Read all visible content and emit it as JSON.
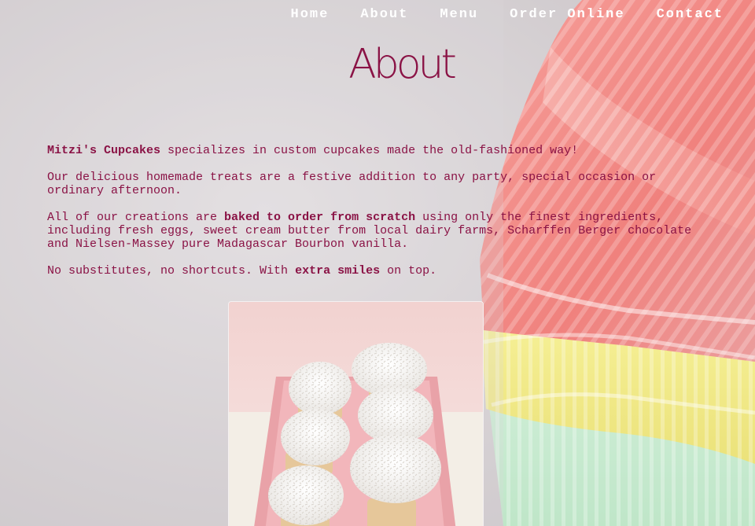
{
  "nav": {
    "items": [
      {
        "label": "Home"
      },
      {
        "label": "About"
      },
      {
        "label": "Menu"
      },
      {
        "label": "Order Online"
      },
      {
        "label": "Contact"
      }
    ]
  },
  "page": {
    "title": "About"
  },
  "about": {
    "p1": {
      "brand": "Mitzi's Cupcakes",
      "rest": " specializes in custom cupcakes made the old-fashioned way!"
    },
    "p2": "Our delicious homemade treats are a festive addition to any party, special occasion or ordinary afternoon.",
    "p3": {
      "pre": "All of our creations are ",
      "bold": "baked to order from scratch",
      "post": " using only the finest ingredients, including fresh eggs, sweet cream butter from local dairy farms, Scharffen Berger chocolate and Nielsen-Massey pure Madagascar Bourbon vanilla."
    },
    "p4": {
      "pre": "No substitutes, no shortcuts. With ",
      "bold": "extra smiles",
      "post": " on top."
    }
  },
  "colors": {
    "accent": "#8a1245",
    "nav_text": "#ffffff",
    "liner_pink": "#f28a86",
    "liner_yellow": "#f4ec88",
    "liner_green": "#c9ecd2"
  },
  "images": {
    "background": "stacked-cupcake-liners",
    "photo": "coconut-cupcakes-on-pink-tray"
  }
}
